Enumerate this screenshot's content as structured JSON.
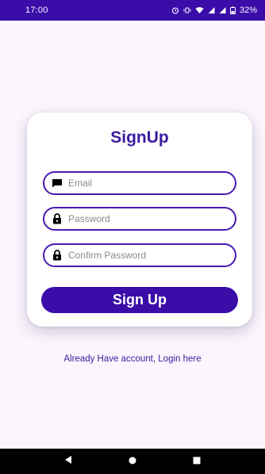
{
  "status_bar": {
    "time": "17:00",
    "battery": "32%",
    "icons": [
      "alarm-icon",
      "vibrate-icon",
      "wifi-icon",
      "signal-icon",
      "signal-icon",
      "battery-icon"
    ]
  },
  "card": {
    "title": "SignUp",
    "email": {
      "placeholder": "Email",
      "value": "",
      "icon": "email-icon"
    },
    "password": {
      "placeholder": "Password",
      "value": "",
      "icon": "lock-icon"
    },
    "confirm_password": {
      "placeholder": "Confirm Password",
      "value": "",
      "icon": "lock-icon"
    },
    "signup_button_label": "Sign Up"
  },
  "login_link": "Already Have account, Login here",
  "nav_bar": {
    "buttons": [
      "back-icon",
      "home-icon",
      "recents-icon"
    ]
  },
  "colors": {
    "primary": "#3a0ca8",
    "background": "#fbf5fd",
    "card": "#ffffff",
    "text_accent": "#3a1ca0"
  }
}
